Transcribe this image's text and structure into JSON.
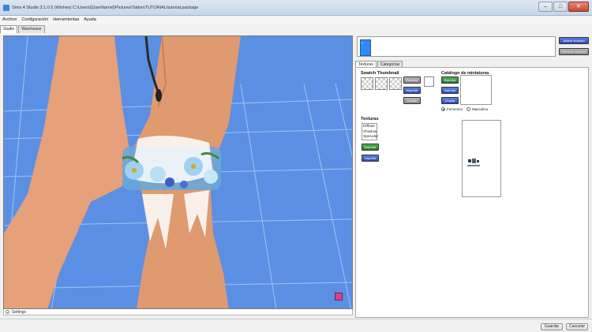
{
  "window": {
    "title": "Sims 4 Studio 3.1.0.5 (Wishes)  C:\\Users\\[UserName]\\Pictures\\Tattoo\\TUTORIAL\\tutorial.package",
    "minimize": "–",
    "maximize": "□",
    "close": "✕"
  },
  "menu": [
    "Archivo",
    "Configuración",
    "Herramientas",
    "Ayuda"
  ],
  "main_tabs": [
    "Studio",
    "Warehouse"
  ],
  "viewport": {
    "settings_label": "Settings",
    "background_color": "#5b8fe3"
  },
  "right": {
    "list": {
      "item_icon": "item-thumbnail"
    },
    "add_button": "Añadir muestra",
    "remove_button": "Eliminar muestra",
    "tabs": [
      "Texturas",
      "Categorías"
    ],
    "swatch": {
      "title": "Swatch Thumbnail",
      "export": "Exportar",
      "import": "Importar",
      "clean": "Limpiar"
    },
    "catalog": {
      "title": "Catálogo de miniaturas",
      "export": "Exportar",
      "import": "Importar",
      "clean": "Limpiar",
      "female": "Femenino",
      "male": "Masculino",
      "selected": "Femenino"
    },
    "textures": {
      "title": "Texturas",
      "items": [
        "Diffuse",
        "Shadow",
        "Specular"
      ],
      "export": "Exportar",
      "import": "Importar"
    }
  },
  "footer": {
    "save": "Guardar",
    "cancel": "Cancelar"
  },
  "colors": {
    "viewport_bg": "#5b8fe3",
    "skin": "#e09a6a",
    "accent_blue": "#2e4bb8",
    "accent_green": "#2a7a2a"
  }
}
